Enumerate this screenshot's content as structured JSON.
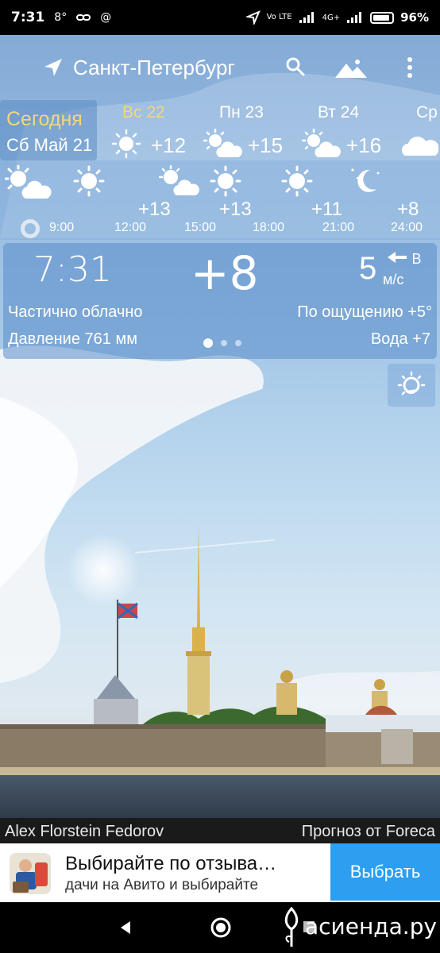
{
  "status_bar": {
    "time": "7:31",
    "temp_indicator": "8°",
    "network_label": "4G+",
    "volte_label": "Vo LTE",
    "battery_percent": "96%"
  },
  "topbar": {
    "city": "Санкт-Петербург"
  },
  "days": {
    "today": {
      "label": "Сегодня",
      "date": "Сб Май 21"
    },
    "items": [
      {
        "label": "Вс 22",
        "temp": "+12",
        "icon": "sun-icon"
      },
      {
        "label": "Пн 23",
        "temp": "+15",
        "icon": "sun-cloud-icon"
      },
      {
        "label": "Вт 24",
        "temp": "+16",
        "icon": "sun-cloud-icon"
      },
      {
        "label": "Ср",
        "temp": "",
        "icon": "cloud-icon"
      }
    ]
  },
  "hours": {
    "times": [
      "9:00",
      "12:00",
      "15:00",
      "18:00",
      "21:00",
      "24:00"
    ],
    "temps": [
      "+13",
      "+13",
      "+11",
      "+8"
    ],
    "icons": [
      "sun-cloud-icon",
      "sun-icon",
      "sun-cloud-icon",
      "sun-icon",
      "sun-icon",
      "moon-stars-icon"
    ]
  },
  "current": {
    "time": "7:31",
    "temperature": "+8",
    "wind_speed": "5",
    "wind_direction": "В",
    "wind_unit": "м/с",
    "condition": "Частично облачно",
    "feels_like": "По ощущению +5°",
    "pressure": "Давление 761 мм",
    "water": "Вода +7"
  },
  "credits": {
    "photographer": "Alex Florstein Fedorov",
    "forecast": "Прогноз от Foreca"
  },
  "ad": {
    "title": "Выбирайте по отзыва…",
    "subtitle": "дачи на Авито и выбирайте",
    "button": "Выбрать"
  },
  "watermark": "асиенда.ру",
  "colors": {
    "today_accent": "#f5d679",
    "ad_button": "#2d9ef0"
  }
}
